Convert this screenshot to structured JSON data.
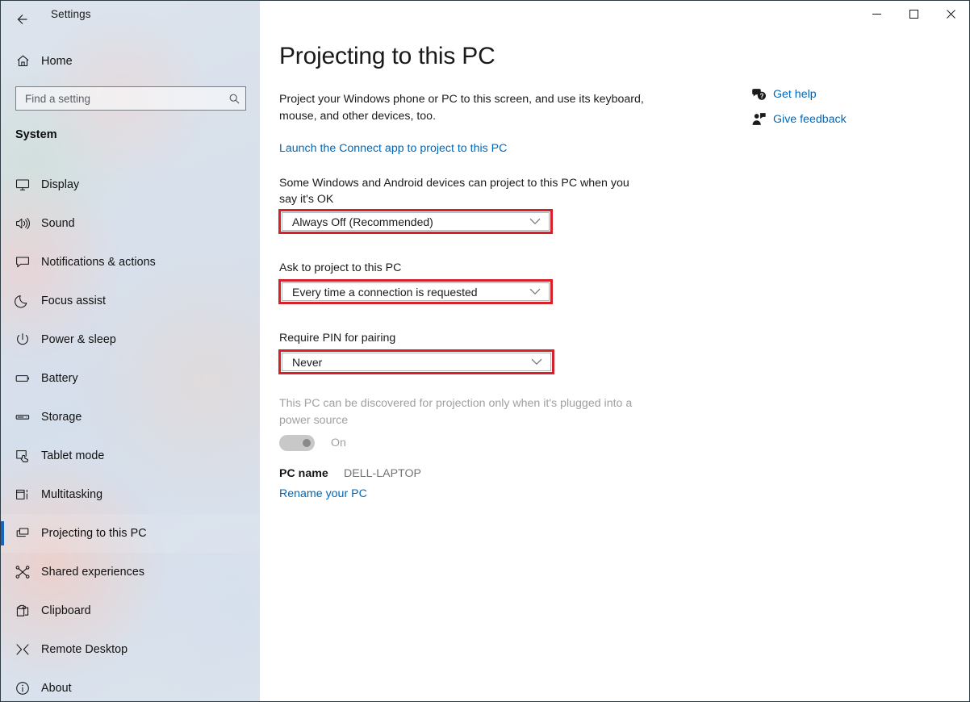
{
  "window": {
    "app_title": "Settings",
    "back_icon": "back-arrow-icon",
    "controls": {
      "minimize": "minimize-icon",
      "maximize": "maximize-icon",
      "close": "close-icon"
    }
  },
  "sidebar": {
    "home": {
      "label": "Home",
      "icon": "home-icon"
    },
    "search": {
      "placeholder": "Find a setting",
      "value": "",
      "icon": "search-icon"
    },
    "section_title": "System",
    "items": [
      {
        "label": "Display",
        "icon": "monitor-icon",
        "selected": false
      },
      {
        "label": "Sound",
        "icon": "speaker-icon",
        "selected": false
      },
      {
        "label": "Notifications & actions",
        "icon": "chat-bubble-icon",
        "selected": false
      },
      {
        "label": "Focus assist",
        "icon": "moon-icon",
        "selected": false
      },
      {
        "label": "Power & sleep",
        "icon": "power-icon",
        "selected": false
      },
      {
        "label": "Battery",
        "icon": "battery-icon",
        "selected": false
      },
      {
        "label": "Storage",
        "icon": "drive-icon",
        "selected": false
      },
      {
        "label": "Tablet mode",
        "icon": "tablet-touch-icon",
        "selected": false
      },
      {
        "label": "Multitasking",
        "icon": "multitask-icon",
        "selected": false
      },
      {
        "label": "Projecting to this PC",
        "icon": "project-screens-icon",
        "selected": true
      },
      {
        "label": "Shared experiences",
        "icon": "share-nodes-icon",
        "selected": false
      },
      {
        "label": "Clipboard",
        "icon": "clipboard-icon",
        "selected": false
      },
      {
        "label": "Remote Desktop",
        "icon": "remote-desktop-icon",
        "selected": false
      },
      {
        "label": "About",
        "icon": "info-icon",
        "selected": false
      }
    ]
  },
  "main": {
    "title": "Projecting to this PC",
    "intro": "Project your Windows phone or PC to this screen, and use its keyboard, mouse, and other devices, too.",
    "connect_link": "Launch the Connect app to project to this PC",
    "settings": [
      {
        "label": "Some Windows and Android devices can project to this PC when you say it's OK",
        "value": "Always Off (Recommended)",
        "highlighted": true
      },
      {
        "label": "Ask to project to this PC",
        "value": "Every time a connection is requested",
        "highlighted": true
      },
      {
        "label": "Require PIN for pairing",
        "value": "Never",
        "highlighted": true
      }
    ],
    "disabled_note": "This PC can be discovered for projection only when it's plugged into a power source",
    "toggle": {
      "state_label": "On",
      "enabled": false,
      "checked": true
    },
    "pc_name": {
      "key": "PC name",
      "value": "DELL-LAPTOP"
    },
    "rename_link": "Rename your PC"
  },
  "right_rail": {
    "items": [
      {
        "label": "Get help",
        "icon": "help-bubble-icon"
      },
      {
        "label": "Give feedback",
        "icon": "feedback-person-icon"
      }
    ]
  },
  "colors": {
    "accent_blue": "#0067b8",
    "selection_blue": "#1565c0",
    "annotation_red": "#d6202a",
    "disabled_grey": "#a0a0a0"
  }
}
